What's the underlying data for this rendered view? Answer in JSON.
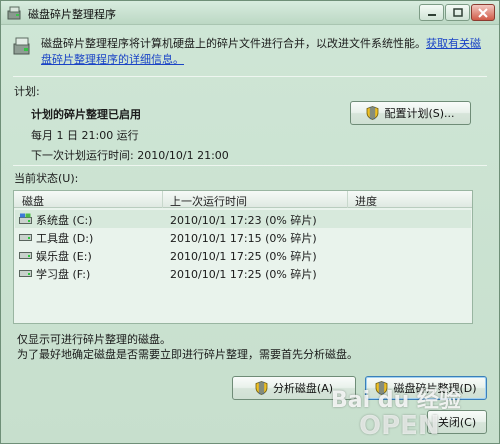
{
  "window": {
    "title": "磁盘碎片整理程序"
  },
  "intro": {
    "text": "磁盘碎片整理程序将计算机硬盘上的碎片文件进行合并，以改进文件系统性能。",
    "link": "获取有关磁盘碎片整理程序的详细信息。"
  },
  "schedule": {
    "section_label": "计划:",
    "status": "计划的碎片整理已启用",
    "frequency": "每月 1 日 21:00 运行",
    "next_run": "下一次计划运行时间: 2010/10/1 21:00",
    "configure_button": "配置计划(S)..."
  },
  "current_status": {
    "section_label": "当前状态(U):",
    "columns": [
      "磁盘",
      "上一次运行时间",
      "进度"
    ],
    "rows": [
      {
        "disk": "系统盘 (C:)",
        "last_run": "2010/10/1 17:23 (0% 碎片)",
        "progress": ""
      },
      {
        "disk": "工具盘 (D:)",
        "last_run": "2010/10/1 17:15 (0% 碎片)",
        "progress": ""
      },
      {
        "disk": "娱乐盘 (E:)",
        "last_run": "2010/10/1 17:25 (0% 碎片)",
        "progress": ""
      },
      {
        "disk": "学习盘 (F:)",
        "last_run": "2010/10/1 17:25 (0% 碎片)",
        "progress": ""
      }
    ]
  },
  "hints": {
    "line1": "仅显示可进行碎片整理的磁盘。",
    "line2": "为了最好地确定磁盘是否需要立即进行碎片整理，需要首先分析磁盘。"
  },
  "buttons": {
    "analyze": "分析磁盘(A)",
    "defrag": "磁盘碎片整理(D)",
    "close": "关闭(C)"
  },
  "watermark": {
    "brand": "Bai du 经验",
    "site": "OPEN"
  },
  "colors": {
    "link": "#1a44c6",
    "window_bg": "#cfe6d6",
    "close_button": "#d05a47"
  }
}
